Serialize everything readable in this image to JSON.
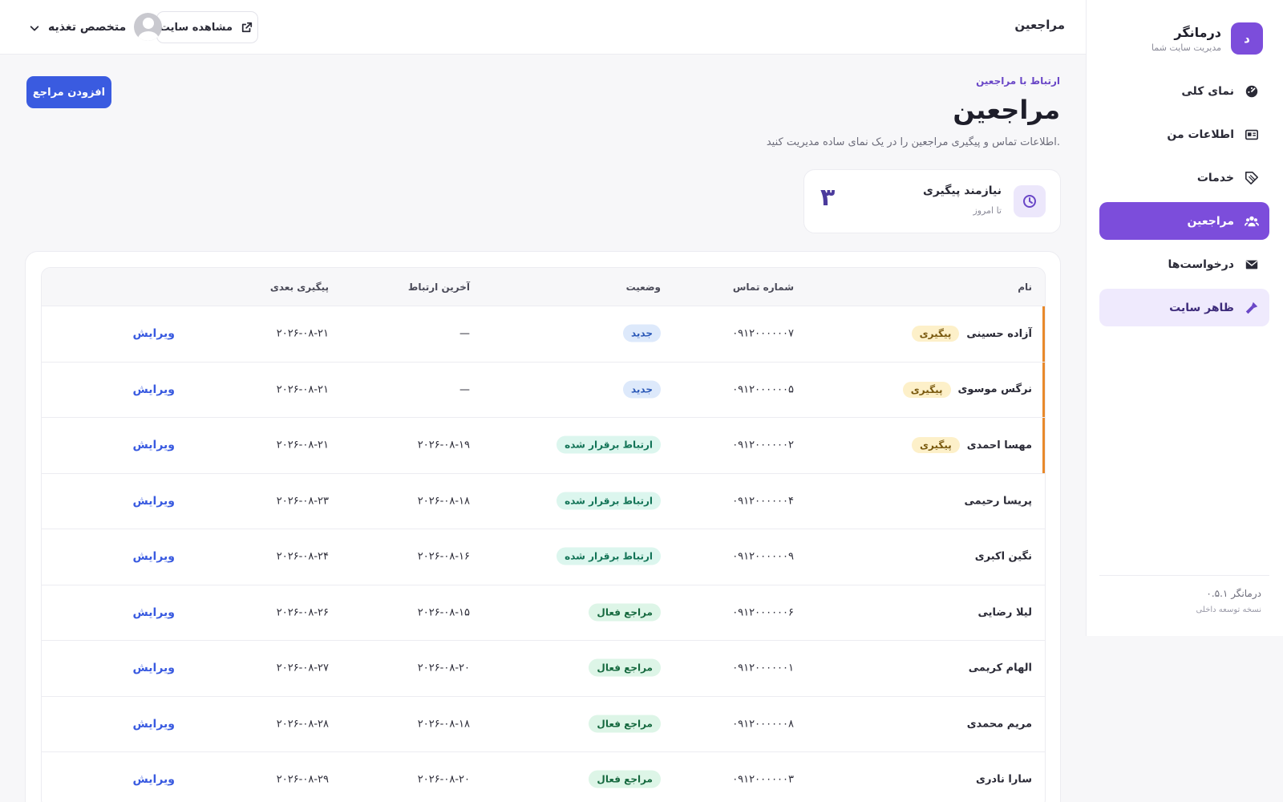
{
  "sidebar": {
    "brand_letter": "د",
    "brand_name": "درمانگر",
    "brand_sub": "مدیریت سایت شما",
    "items": [
      {
        "label": "نمای کلی",
        "icon": "dashboard-icon"
      },
      {
        "label": "اطلاعات من",
        "icon": "id-card-icon"
      },
      {
        "label": "خدمات",
        "icon": "tag-icon"
      },
      {
        "label": "مراجعین",
        "icon": "users-icon"
      },
      {
        "label": "درخواست‌ها",
        "icon": "envelope-icon"
      },
      {
        "label": "ظاهر سایت",
        "icon": "paint-icon"
      }
    ],
    "version_name": "درمانگر ۰.۵.۱",
    "version_sub": "نسخه توسعه داخلی"
  },
  "topbar": {
    "title": "مراجعین",
    "site_button": "مشاهده سایت",
    "user_name": "متخصص تغذیه"
  },
  "header": {
    "eyebrow": "ارتباط با مراجعین",
    "title": "مراجعین",
    "description": "اطلاعات تماس و پیگیری مراجعین را در یک نمای ساده مدیریت کنید.",
    "add_button": "افزودن مراجع"
  },
  "stat": {
    "label": "نیازمند پیگیری",
    "sub": "تا امروز",
    "value": "۳"
  },
  "table": {
    "headers": {
      "name": "نام",
      "phone": "شماره تماس",
      "status": "وضعیت",
      "last": "آخرین ارتباط",
      "next": "پیگیری بعدی"
    },
    "rows": [
      {
        "name": "آزاده حسینی",
        "badge": "پیگیری",
        "phone": "۰۹۱۲۰۰۰۰۰۰۷",
        "status": "جدید",
        "last": "—",
        "next": "۲۰۲۶-۰۸-۲۱",
        "action": "ویرایش"
      },
      {
        "name": "نرگس موسوی",
        "badge": "پیگیری",
        "phone": "۰۹۱۲۰۰۰۰۰۰۵",
        "status": "جدید",
        "last": "—",
        "next": "۲۰۲۶-۰۸-۲۱",
        "action": "ویرایش"
      },
      {
        "name": "مهسا احمدی",
        "badge": "پیگیری",
        "phone": "۰۹۱۲۰۰۰۰۰۰۲",
        "status": "ارتباط برقرار شده",
        "last": "۲۰۲۶-۰۸-۱۹",
        "next": "۲۰۲۶-۰۸-۲۱",
        "action": "ویرایش"
      },
      {
        "name": "پریسا رحیمی",
        "badge": "",
        "phone": "۰۹۱۲۰۰۰۰۰۰۴",
        "status": "ارتباط برقرار شده",
        "last": "۲۰۲۶-۰۸-۱۸",
        "next": "۲۰۲۶-۰۸-۲۳",
        "action": "ویرایش"
      },
      {
        "name": "نگین اکبری",
        "badge": "",
        "phone": "۰۹۱۲۰۰۰۰۰۰۹",
        "status": "ارتباط برقرار شده",
        "last": "۲۰۲۶-۰۸-۱۶",
        "next": "۲۰۲۶-۰۸-۲۴",
        "action": "ویرایش"
      },
      {
        "name": "لیلا رضایی",
        "badge": "",
        "phone": "۰۹۱۲۰۰۰۰۰۰۶",
        "status": "مراجع فعال",
        "last": "۲۰۲۶-۰۸-۱۵",
        "next": "۲۰۲۶-۰۸-۲۶",
        "action": "ویرایش"
      },
      {
        "name": "الهام کریمی",
        "badge": "",
        "phone": "۰۹۱۲۰۰۰۰۰۰۱",
        "status": "مراجع فعال",
        "last": "۲۰۲۶-۰۸-۲۰",
        "next": "۲۰۲۶-۰۸-۲۷",
        "action": "ویرایش"
      },
      {
        "name": "مریم محمدی",
        "badge": "",
        "phone": "۰۹۱۲۰۰۰۰۰۰۸",
        "status": "مراجع فعال",
        "last": "۲۰۲۶-۰۸-۱۸",
        "next": "۲۰۲۶-۰۸-۲۸",
        "action": "ویرایش"
      },
      {
        "name": "سارا نادری",
        "badge": "",
        "phone": "۰۹۱۲۰۰۰۰۰۰۳",
        "status": "مراجع فعال",
        "last": "۲۰۲۶-۰۸-۲۰",
        "next": "۲۰۲۶-۰۸-۲۹",
        "action": "ویرایش"
      }
    ]
  },
  "colors": {
    "accent": "#7c4ddb",
    "primary_button": "#3a5be0",
    "followup_flag": "#e8892b"
  }
}
